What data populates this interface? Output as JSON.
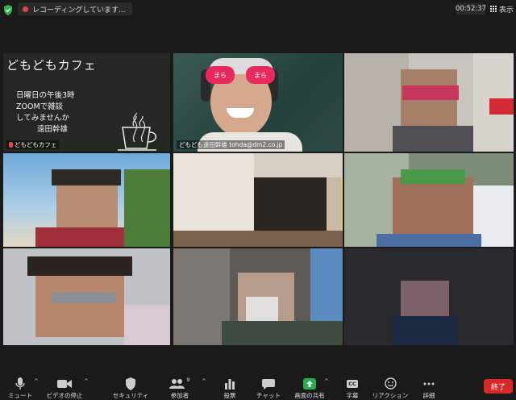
{
  "topbar": {
    "recording_text": "レコーディングしています...",
    "timer": "00:52:37",
    "view_label": "表示"
  },
  "tiles": {
    "cafe": {
      "title": "どもどもカフェ",
      "line1": "日曜日の午後3時",
      "line2": "ZOOMで雑談",
      "line3": "してみませんか",
      "line4": "遠田幹雄",
      "name": "どもどもカフェ"
    },
    "host": {
      "name": "どもども遠田幹雄 tohda@dm2.co.jp",
      "glasses_text": "まら まら"
    }
  },
  "toolbar": {
    "mute": "ミュート",
    "video": "ビデオの停止",
    "security": "セキュリティ",
    "participants": "参加者",
    "participants_count": "9",
    "polls": "投票",
    "chat": "チャット",
    "share": "画面の共有",
    "captions": "字幕",
    "captions_icon": "CC",
    "reactions": "リアクション",
    "more": "詳細",
    "end": "終了"
  }
}
